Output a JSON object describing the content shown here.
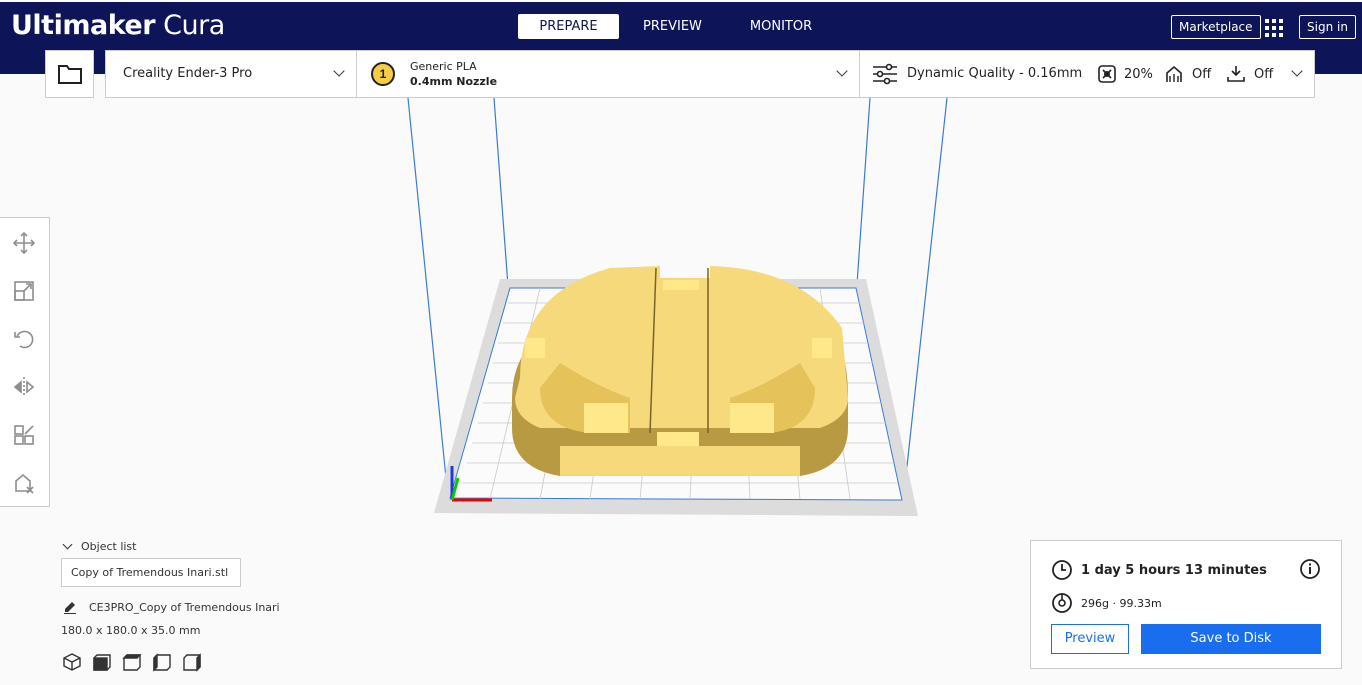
{
  "app": {
    "brand_bold": "Ultimaker",
    "brand_light": "Cura"
  },
  "stages": [
    {
      "label": "PREPARE",
      "active": true
    },
    {
      "label": "PREVIEW",
      "active": false
    },
    {
      "label": "MONITOR",
      "active": false
    }
  ],
  "header": {
    "marketplace_label": "Marketplace",
    "signin_label": "Sign in"
  },
  "printer": {
    "name": "Creality Ender-3 Pro"
  },
  "material": {
    "extruder_number": "1",
    "name": "Generic PLA",
    "nozzle": "0.4mm Nozzle"
  },
  "profile": {
    "name": "Dynamic Quality - 0.16mm",
    "infill": "20%",
    "support": "Off",
    "adhesion": "Off"
  },
  "object_list": {
    "header": "Object list",
    "file": "Copy of Tremendous Inari.stl",
    "job_name": "CE3PRO_Copy of Tremendous Inari",
    "dimensions": "180.0 x 180.0 x 35.0 mm"
  },
  "print": {
    "time": "1 day 5 hours 13 minutes",
    "material": "296g · 99.33m",
    "preview_label": "Preview",
    "save_label": "Save to Disk"
  },
  "colors": {
    "header_bg": "#0d1458",
    "accent": "#196ef0",
    "model": "#f5d97a"
  }
}
